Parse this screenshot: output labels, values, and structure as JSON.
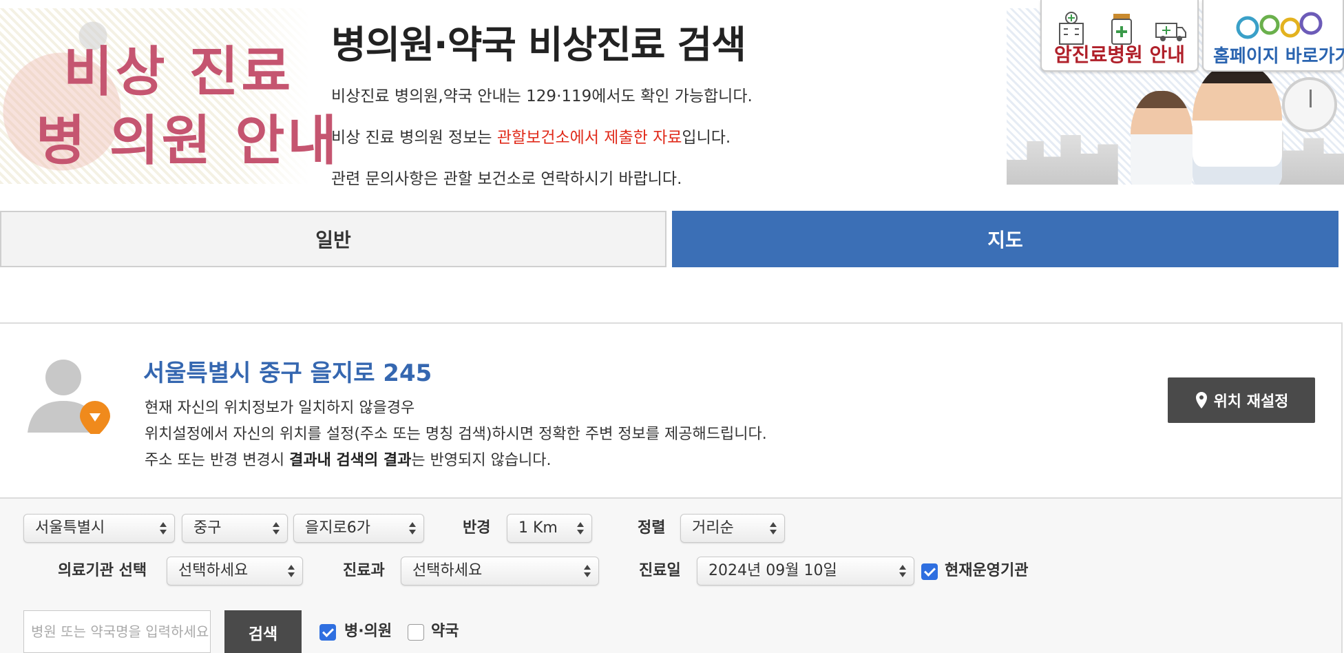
{
  "header": {
    "hero_line1": "비상 진료",
    "hero_line2": "병 의원 안내",
    "title": "병의원·약국 비상진료 검색",
    "info1": "비상진료 병의원,약국 안내는 129·119에서도 확인 가능합니다.",
    "info2_before": "비상 진료 병의원 정보는 ",
    "info2_highlight": "관할보건소에서 제출한 자료",
    "info2_after": "입니다.",
    "info3": "관련 문의사항은 관할 보건소로 연락하시기 바랍니다.",
    "card1_label": "암진료병원 안내",
    "card2_label": "홈페이지 바로가기"
  },
  "tabs": {
    "general": "일반",
    "map": "지도"
  },
  "location": {
    "address": "서울특별시 중구 을지로 245",
    "desc1": "현재 자신의 위치정보가 일치하지 않을경우",
    "desc2": "위치설정에서 자신의 위치를 설정(주소 또는 명칭 검색)하시면 정확한 주변 정보를 제공해드립니다.",
    "desc3_before": "주소 또는 반경 변경시 ",
    "desc3_bold": "결과내 검색의 결과",
    "desc3_after": "는 반영되지 않습니다.",
    "reset_label": "위치 재설정"
  },
  "filters": {
    "city": "서울특별시",
    "district": "중구",
    "dong": "을지로6가",
    "radius_label": "반경",
    "radius": "1 Km",
    "sort_label": "정렬",
    "sort": "거리순",
    "institution_label": "의료기관 선택",
    "institution": "선택하세요",
    "dept_label": "진료과",
    "dept": "선택하세요",
    "date_label": "진료일",
    "date": "2024년 09월 10일",
    "operating_label": "현재운영기관",
    "operating_checked": true
  },
  "search": {
    "placeholder": "병원 또는 약국명을 입력하세요",
    "button": "검색",
    "hospital_label": "병·의원",
    "hospital_checked": true,
    "pharmacy_label": "약국",
    "pharmacy_checked": false
  },
  "colors": {
    "accent_blue": "#3b6fb6",
    "address_blue": "#3567b0",
    "highlight_red": "#e02a1a",
    "dark_button": "#4a4a4a",
    "hero_pink": "#c55570",
    "checkbox_blue": "#2f6fe0"
  }
}
